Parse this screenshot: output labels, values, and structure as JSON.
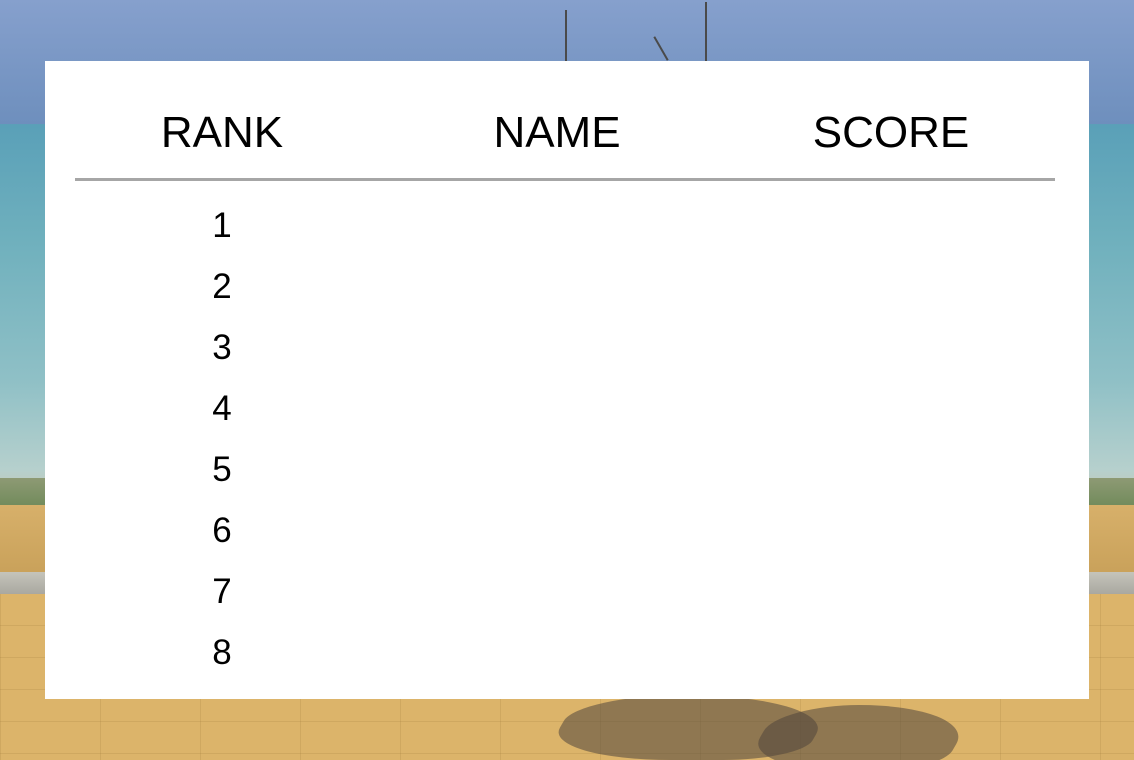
{
  "leaderboard": {
    "headers": {
      "rank": "RANK",
      "name": "NAME",
      "score": "SCORE"
    },
    "rows": [
      {
        "rank": "1",
        "name": "",
        "score": ""
      },
      {
        "rank": "2",
        "name": "",
        "score": ""
      },
      {
        "rank": "3",
        "name": "",
        "score": ""
      },
      {
        "rank": "4",
        "name": "",
        "score": ""
      },
      {
        "rank": "5",
        "name": "",
        "score": ""
      },
      {
        "rank": "6",
        "name": "",
        "score": ""
      },
      {
        "rank": "7",
        "name": "",
        "score": ""
      },
      {
        "rank": "8",
        "name": "",
        "score": ""
      }
    ]
  },
  "colors": {
    "panel": "#ffffff",
    "divider": "#a6a6a6",
    "text": "#000000"
  }
}
